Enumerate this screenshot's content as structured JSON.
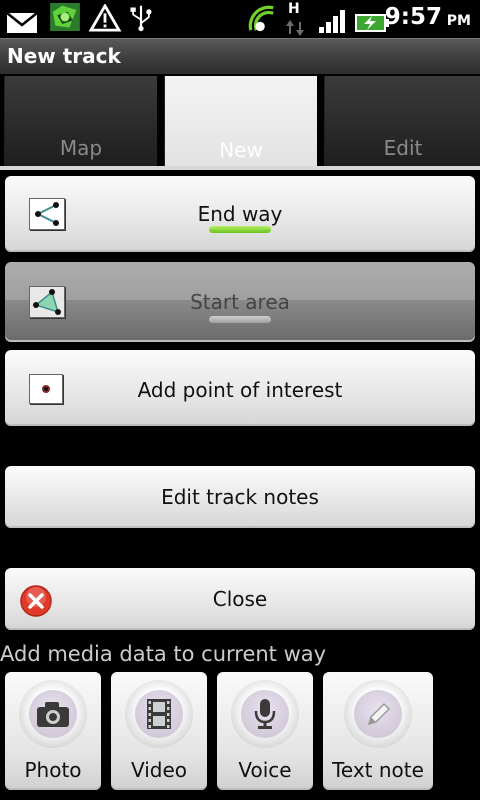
{
  "status_bar": {
    "icons": [
      "mail-icon",
      "app-notification-icon",
      "warning-icon",
      "usb-icon",
      "gps-signal-icon",
      "network-h-icon",
      "signal-bars-icon",
      "battery-charging-icon"
    ],
    "network_type": "H",
    "time": "9:57",
    "ampm": "PM"
  },
  "title_bar": {
    "title": "New track"
  },
  "tabs": [
    {
      "label": "Map",
      "active": false
    },
    {
      "label": "New",
      "active": true
    },
    {
      "label": "Edit",
      "active": false
    }
  ],
  "actions": {
    "end_way": {
      "label": "End way",
      "indicator_color": "#7fd21f",
      "icon": "way-icon"
    },
    "start_area": {
      "label": "Start area",
      "state": "pressed",
      "icon": "area-icon"
    },
    "add_poi": {
      "label": "Add point of interest",
      "icon": "poi-icon"
    },
    "edit_notes": {
      "label": "Edit track notes"
    },
    "close": {
      "label": "Close",
      "icon": "close-icon"
    }
  },
  "media": {
    "title": "Add media data to current way",
    "buttons": [
      {
        "label": "Photo",
        "icon": "camera-icon"
      },
      {
        "label": "Video",
        "icon": "film-icon"
      },
      {
        "label": "Voice",
        "icon": "microphone-icon"
      },
      {
        "label": "Text note",
        "icon": "pencil-icon"
      }
    ]
  }
}
